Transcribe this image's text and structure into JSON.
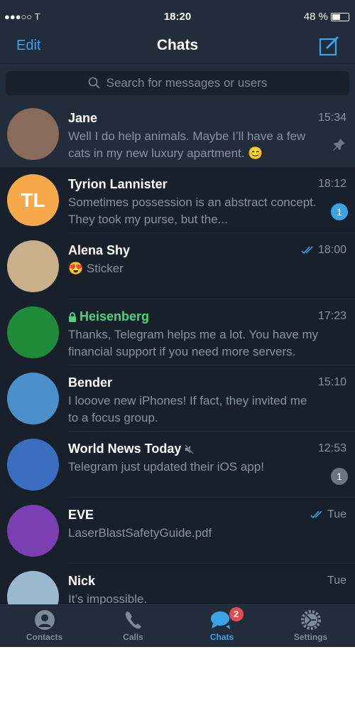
{
  "status_bar": {
    "carrier": "●●●○○ T",
    "time": "18:20",
    "battery": "48 %",
    "battery_level": 48
  },
  "header": {
    "edit_label": "Edit",
    "title": "Chats"
  },
  "search": {
    "placeholder": "Search for messages or users"
  },
  "chats": [
    {
      "name": "Jane",
      "time": "15:34",
      "message": "Well I do help animals. Maybe I’ll have a few cats in my new luxury apartment. 😊",
      "pinned": true,
      "avatar_color": "#8a6a5a"
    },
    {
      "name": "Tyrion Lannister",
      "initials": "TL",
      "time": "18:12",
      "message": "Sometimes possession is an abstract concept. They took my purse, but the...",
      "unread": "1",
      "avatar_color": "#f7a84a"
    },
    {
      "name": "Alena Shy",
      "time": "18:00",
      "message": "😍 Sticker",
      "read": true,
      "avatar_color": "#c9b08a"
    },
    {
      "name": "Heisenberg",
      "time": "17:23",
      "message": "Thanks, Telegram helps me a lot. You have my financial support if you need more servers.",
      "secret": true,
      "avatar_color": "#1e8a3a"
    },
    {
      "name": "Bender",
      "time": "15:10",
      "message": "I looove new iPhones! If fact, they invited me to a focus group.",
      "avatar_color": "#4a8fc7"
    },
    {
      "name": "World News Today",
      "time": "12:53",
      "message": "Telegram just updated their iOS app!",
      "muted": true,
      "unread": "1",
      "avatar_color": "#3a6fc0"
    },
    {
      "name": "EVE",
      "time": "Tue",
      "message": "LaserBlastSafetyGuide.pdf",
      "read": true,
      "avatar_color": "#7a3fb0"
    },
    {
      "name": "Nick",
      "time": "Tue",
      "message": "It’s impossible.",
      "avatar_color": "#9ab8d0"
    }
  ],
  "tabs": [
    {
      "label": "Contacts"
    },
    {
      "label": "Calls"
    },
    {
      "label": "Chats",
      "badge": "2",
      "active": true
    },
    {
      "label": "Settings"
    }
  ],
  "colors": {
    "accent": "#3ba3e6",
    "background": "#18202b",
    "header": "#212d3b",
    "secret": "#4fd27a",
    "badge": "#e5484d"
  }
}
